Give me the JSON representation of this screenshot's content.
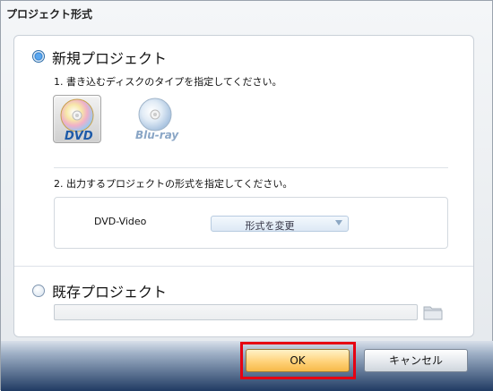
{
  "window": {
    "title": "プロジェクト形式"
  },
  "new_project": {
    "label": "新規プロジェクト",
    "selected": true,
    "step1": "1. 書き込むディスクのタイプを指定してください。",
    "disc_types": [
      {
        "label": "DVD",
        "icon": "dvd-disc-icon",
        "selected": true
      },
      {
        "label": "Blu-ray",
        "icon": "bluray-disc-icon",
        "selected": false
      }
    ],
    "step2": "2. 出力するプロジェクトの形式を指定してください。",
    "format_name": "DVD-Video",
    "format_button": "形式を変更"
  },
  "existing_project": {
    "label": "既存プロジェクト",
    "selected": false,
    "path_value": ""
  },
  "buttons": {
    "ok": "OK",
    "cancel": "キャンセル"
  },
  "colors": {
    "highlight": "#e60012",
    "ok_button": "#ffd27a",
    "footer": "#203b63",
    "dvd_text": "#1d5aa8",
    "bluray_text": "#8aa6c6"
  }
}
